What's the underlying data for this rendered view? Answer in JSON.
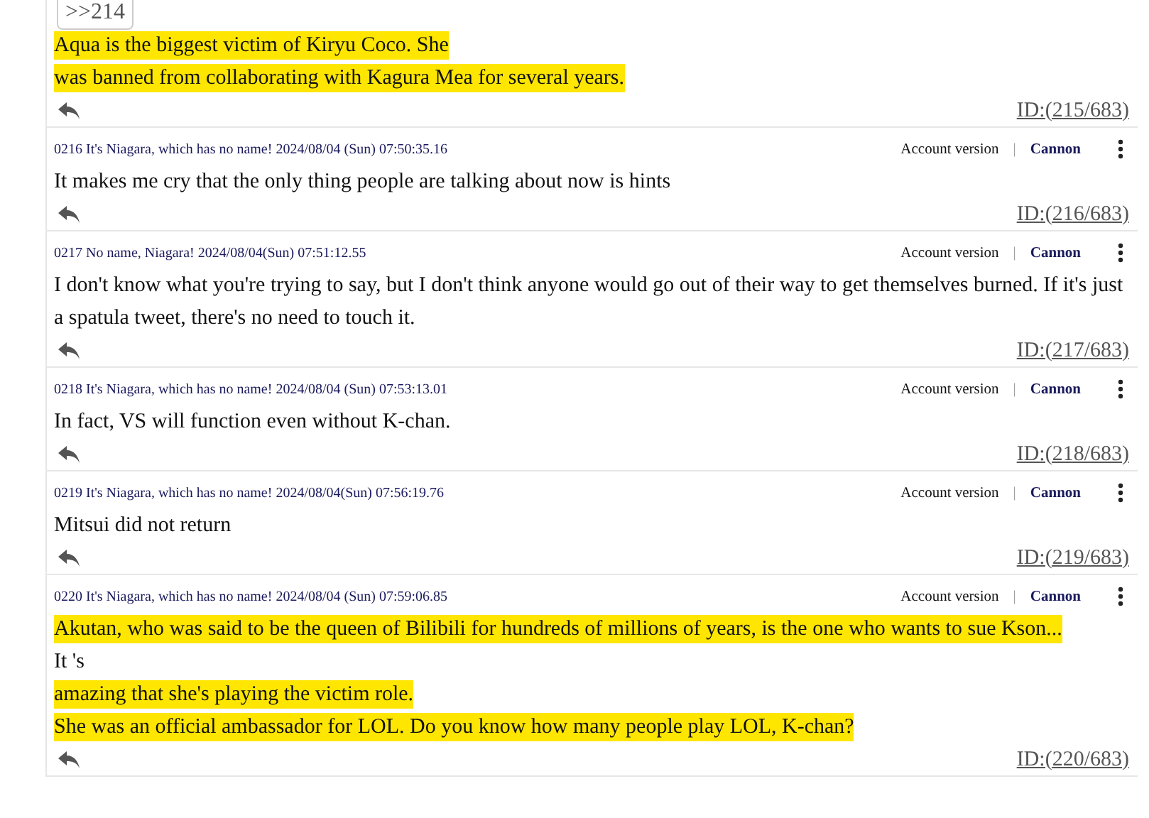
{
  "posts": [
    {
      "quote": ">>214",
      "lines": [
        {
          "text": "Aqua is the biggest victim of Kiryu Coco. She",
          "highlighted": true
        },
        {
          "text": "was banned from collaborating with Kagura Mea for several years.",
          "highlighted": true
        }
      ],
      "id": "ID:(215/683)"
    },
    {
      "header": {
        "meta": "0216 It's Niagara, which has no name! 2024/08/04 (Sun) 07:50:35.16",
        "account": "Account version",
        "separator": "|",
        "cannon": "Cannon"
      },
      "lines": [
        {
          "text": "It makes me cry that the only thing people are talking about now is hints",
          "highlighted": false
        }
      ],
      "id": "ID:(216/683)"
    },
    {
      "header": {
        "meta": "0217 No name, Niagara! 2024/08/04(Sun) 07:51:12.55",
        "account": "Account version",
        "separator": "|",
        "cannon": "Cannon"
      },
      "lines": [
        {
          "text": "I don't know what you're trying to say, but I don't think anyone would go out of their way to get themselves burned. If it's just a spatula tweet, there's no need to touch it.",
          "highlighted": false
        }
      ],
      "id": "ID:(217/683)"
    },
    {
      "header": {
        "meta": "0218 It's Niagara, which has no name! 2024/08/04 (Sun) 07:53:13.01",
        "account": "Account version",
        "separator": "|",
        "cannon": "Cannon"
      },
      "lines": [
        {
          "text": "In fact, VS will function even without K-chan.",
          "highlighted": false
        }
      ],
      "id": "ID:(218/683)"
    },
    {
      "header": {
        "meta": "0219 It's Niagara, which has no name! 2024/08/04(Sun) 07:56:19.76",
        "account": "Account version",
        "separator": "|",
        "cannon": "Cannon"
      },
      "lines": [
        {
          "text": "Mitsui did not return",
          "highlighted": false
        }
      ],
      "id": "ID:(219/683)"
    },
    {
      "header": {
        "meta": "0220 It's Niagara, which has no name! 2024/08/04 (Sun) 07:59:06.85",
        "account": "Account version",
        "separator": "|",
        "cannon": "Cannon"
      },
      "lines": [
        {
          "text": "Akutan, who was said to be the queen of Bilibili for hundreds of millions of years, is the one who wants to sue Kson...",
          "highlighted": true
        },
        {
          "text": "It 's",
          "highlighted": false
        },
        {
          "text": "amazing that she's playing the victim role.",
          "highlighted": true
        },
        {
          "text": "She was an official ambassador for LOL. Do you know how many people play LOL, K-chan?",
          "highlighted": true
        }
      ],
      "id": "ID:(220/683)"
    }
  ]
}
